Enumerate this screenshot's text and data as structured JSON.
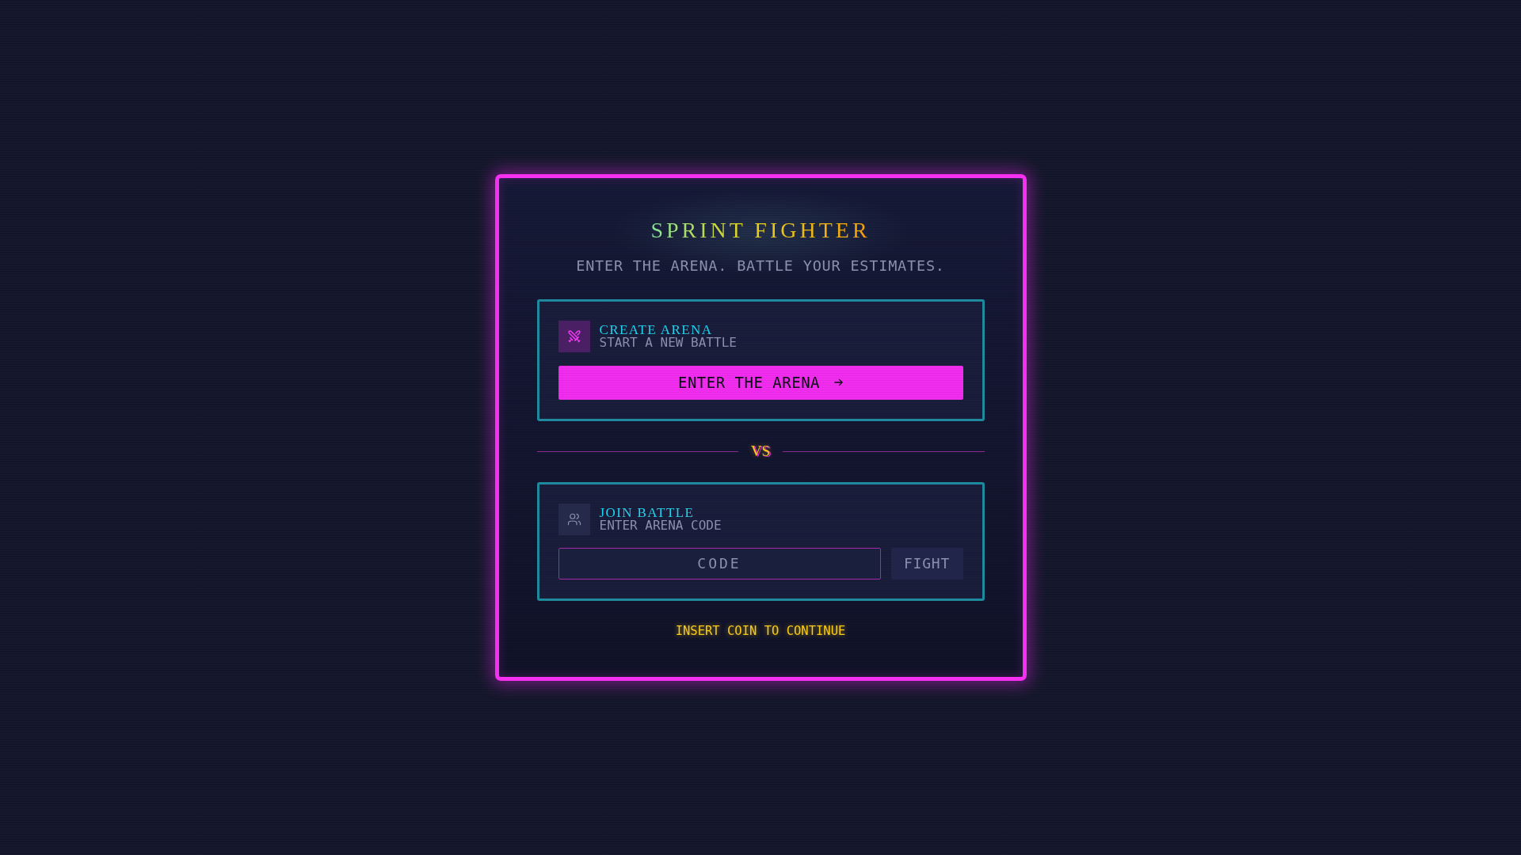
{
  "title": "SPRINT FIGHTER",
  "subtitle": "ENTER THE ARENA. BATTLE YOUR ESTIMATES.",
  "sections": [
    {
      "kind": "create",
      "title": "CREATE ARENA",
      "subtitle": "START A NEW BATTLE",
      "button": {
        "label": "ENTER THE ARENA",
        "disabled": false
      }
    },
    {
      "kind": "divider",
      "label": "VS"
    },
    {
      "kind": "join",
      "title": "JOIN BATTLE",
      "subtitle": "ENTER ARENA CODE",
      "input": {
        "placeholder": "CODE"
      },
      "button": {
        "label": "FIGHT",
        "disabled": true
      }
    }
  ],
  "footer": "INSERT COIN TO CONTINUE"
}
